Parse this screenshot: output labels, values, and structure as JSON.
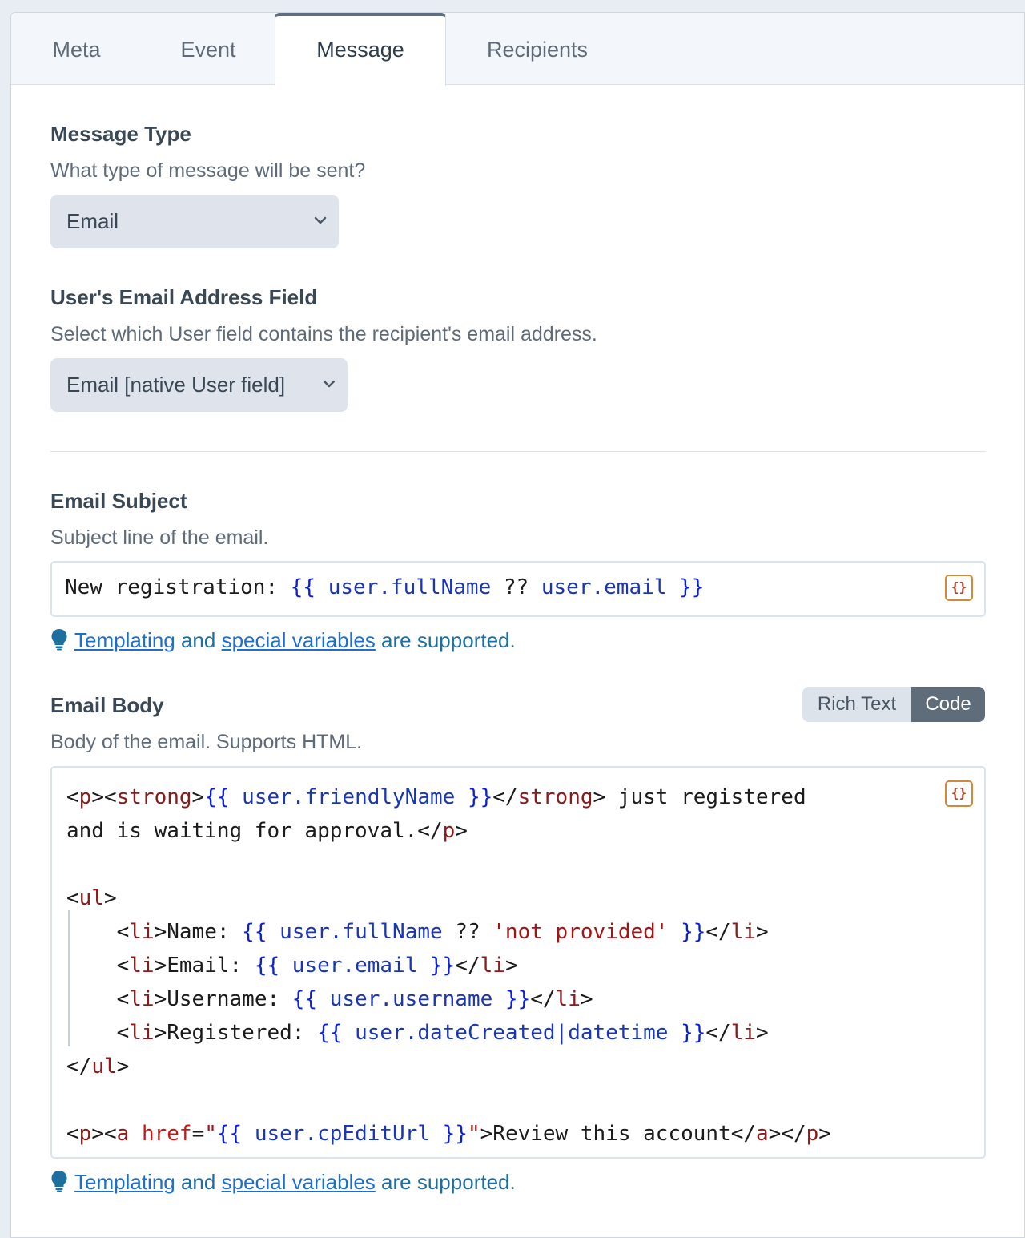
{
  "tabs": [
    "Meta",
    "Event",
    "Message",
    "Recipients"
  ],
  "active_tab": "Message",
  "message_type": {
    "heading": "Message Type",
    "description": "What type of message will be sent?",
    "selected": "Email"
  },
  "email_field": {
    "heading": "User's Email Address Field",
    "description": "Select which User field contains the recipient's email address.",
    "selected": "Email [native User field]"
  },
  "subject": {
    "heading": "Email Subject",
    "description": "Subject line of the email.",
    "value": "New registration: {{ user.fullName ?? user.email }}"
  },
  "body": {
    "heading": "Email Body",
    "description": "Body of the email. Supports HTML.",
    "mode_options": [
      "Rich Text",
      "Code"
    ],
    "mode_selected": "Code",
    "code_lines": [
      "<p><strong>{{ user.friendlyName }}</strong> just registered",
      "and is waiting for approval.</p>",
      "",
      "<ul>",
      "    <li>Name: {{ user.fullName ?? 'not provided' }}</li>",
      "    <li>Email: {{ user.email }}</li>",
      "    <li>Username: {{ user.username }}</li>",
      "    <li>Registered: {{ user.dateCreated|datetime }}</li>",
      "</ul>",
      "",
      "<p><a href=\"{{ user.cpEditUrl }}\">Review this account</a></p>"
    ]
  },
  "tip": {
    "link1": "Templating",
    "and": "and",
    "link2": "special variables",
    "suffix": "are supported."
  },
  "variable_button_label": "{}",
  "colors": {
    "tag": "#8b1a1a",
    "twig_delim": "#0a1fd6",
    "twig_prop": "#1a36b8",
    "string": "#a31515",
    "link": "#1d6fc9",
    "active_toggle": "#5f6c7a"
  }
}
